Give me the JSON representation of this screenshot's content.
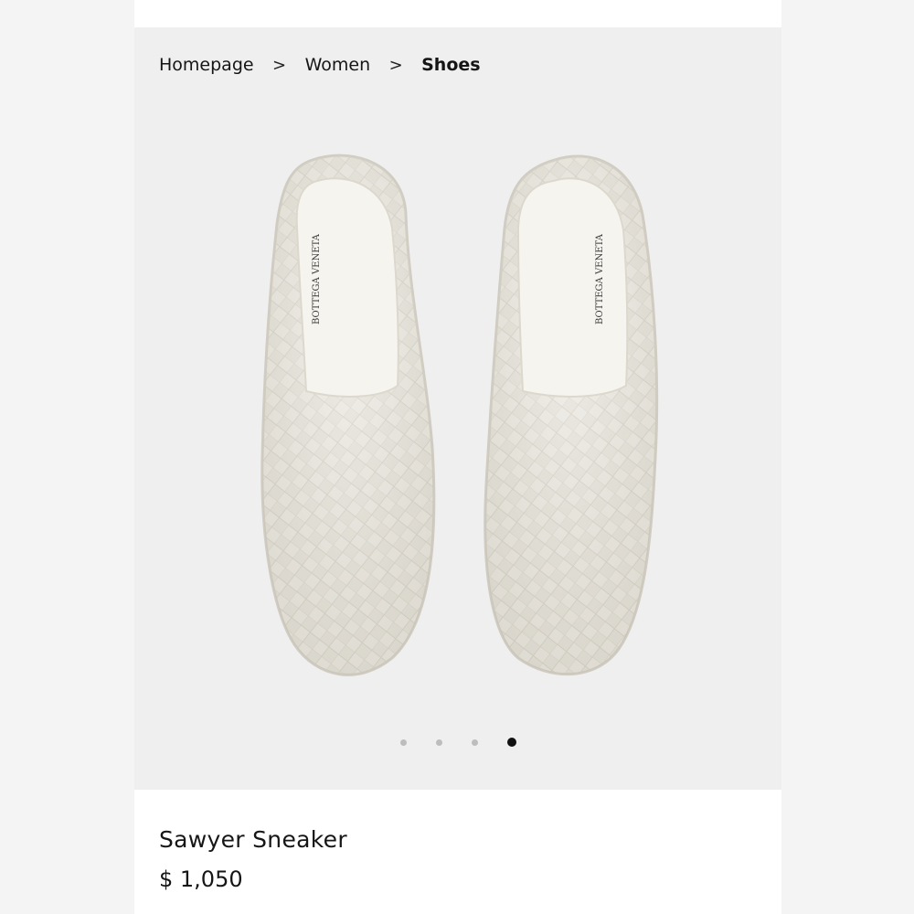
{
  "breadcrumb": {
    "items": [
      "Homepage",
      "Women",
      "Shoes"
    ],
    "separator": ">"
  },
  "product_image": {
    "brand_insole_text": "BOTTEGA VENETA",
    "carousel_total": 4,
    "carousel_active_index": 3
  },
  "product": {
    "name": "Sawyer Sneaker",
    "price": "$ 1,050"
  },
  "colors": {
    "hero_background": "#efefef",
    "shoe_leather": "#ebe8e0",
    "active_dot": "#111111",
    "inactive_dot": "#bdbdbd"
  }
}
